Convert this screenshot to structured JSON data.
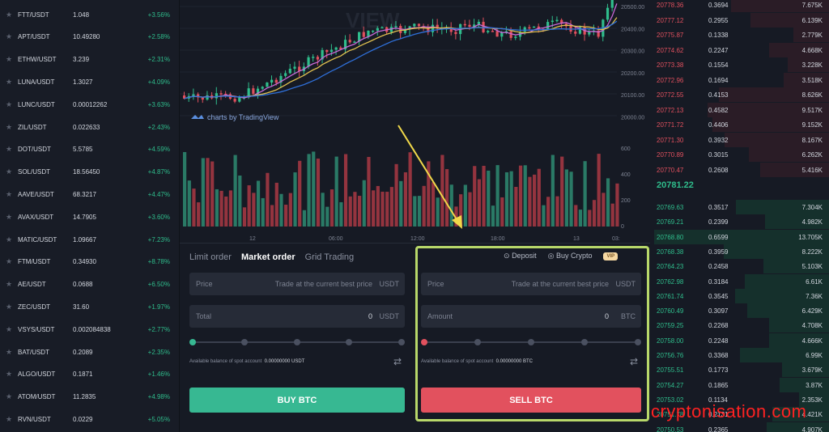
{
  "markets": [
    {
      "symbol": "FTT/USDT",
      "price": "1.048",
      "change": "+3.56%"
    },
    {
      "symbol": "APT/USDT",
      "price": "10.49280",
      "change": "+2.58%"
    },
    {
      "symbol": "ETHW/USDT",
      "price": "3.239",
      "change": "+2.31%"
    },
    {
      "symbol": "LUNA/USDT",
      "price": "1.3027",
      "change": "+4.09%"
    },
    {
      "symbol": "LUNC/USDT",
      "price": "0.00012262",
      "change": "+3.63%"
    },
    {
      "symbol": "ZIL/USDT",
      "price": "0.022633",
      "change": "+2.43%"
    },
    {
      "symbol": "DOT/USDT",
      "price": "5.5785",
      "change": "+4.59%"
    },
    {
      "symbol": "SOL/USDT",
      "price": "18.56450",
      "change": "+4.87%"
    },
    {
      "symbol": "AAVE/USDT",
      "price": "68.3217",
      "change": "+4.47%"
    },
    {
      "symbol": "AVAX/USDT",
      "price": "14.7905",
      "change": "+3.60%"
    },
    {
      "symbol": "MATIC/USDT",
      "price": "1.09667",
      "change": "+7.23%"
    },
    {
      "symbol": "FTM/USDT",
      "price": "0.34930",
      "change": "+8.78%"
    },
    {
      "symbol": "AE/USDT",
      "price": "0.0688",
      "change": "+6.50%"
    },
    {
      "symbol": "ZEC/USDT",
      "price": "31.60",
      "change": "+1.97%"
    },
    {
      "symbol": "VSYS/USDT",
      "price": "0.002084838",
      "change": "+2.77%"
    },
    {
      "symbol": "BAT/USDT",
      "price": "0.2089",
      "change": "+2.35%"
    },
    {
      "symbol": "ALGO/USDT",
      "price": "0.1871",
      "change": "+1.46%"
    },
    {
      "symbol": "ATOM/USDT",
      "price": "11.2835",
      "change": "+4.98%"
    },
    {
      "symbol": "RVN/USDT",
      "price": "0.0229",
      "change": "+5.05%"
    }
  ],
  "chart": {
    "price_ticks": [
      "20500.00",
      "20400.00",
      "20300.00",
      "20200.00",
      "20100.00",
      "20000.00"
    ],
    "volume_ticks": [
      "600",
      "400",
      "200",
      "0"
    ],
    "time_ticks": [
      "12",
      "06:00",
      "12:00",
      "18:00",
      "13",
      "03:"
    ],
    "tradingview_label": "charts by TradingView",
    "watermark_text": "VIEW"
  },
  "orderbook": {
    "asks": [
      {
        "price": "20778.36",
        "amount": "0.3694",
        "total": "7.675K"
      },
      {
        "price": "20777.12",
        "amount": "0.2955",
        "total": "6.139K"
      },
      {
        "price": "20775.87",
        "amount": "0.1338",
        "total": "2.779K"
      },
      {
        "price": "20774.62",
        "amount": "0.2247",
        "total": "4.668K"
      },
      {
        "price": "20773.38",
        "amount": "0.1554",
        "total": "3.228K"
      },
      {
        "price": "20772.96",
        "amount": "0.1694",
        "total": "3.518K"
      },
      {
        "price": "20772.55",
        "amount": "0.4153",
        "total": "8.626K"
      },
      {
        "price": "20772.13",
        "amount": "0.4582",
        "total": "9.517K"
      },
      {
        "price": "20771.72",
        "amount": "0.4406",
        "total": "9.152K"
      },
      {
        "price": "20771.30",
        "amount": "0.3932",
        "total": "8.167K"
      },
      {
        "price": "20770.89",
        "amount": "0.3015",
        "total": "6.262K"
      },
      {
        "price": "20770.47",
        "amount": "0.2608",
        "total": "5.416K"
      }
    ],
    "last_price": "20781.22",
    "bids": [
      {
        "price": "20769.63",
        "amount": "0.3517",
        "total": "7.304K"
      },
      {
        "price": "20769.21",
        "amount": "0.2399",
        "total": "4.982K"
      },
      {
        "price": "20768.80",
        "amount": "0.6599",
        "total": "13.705K"
      },
      {
        "price": "20768.38",
        "amount": "0.3959",
        "total": "8.222K"
      },
      {
        "price": "20764.23",
        "amount": "0.2458",
        "total": "5.103K"
      },
      {
        "price": "20762.98",
        "amount": "0.3184",
        "total": "6.61K"
      },
      {
        "price": "20761.74",
        "amount": "0.3545",
        "total": "7.36K"
      },
      {
        "price": "20760.49",
        "amount": "0.3097",
        "total": "6.429K"
      },
      {
        "price": "20759.25",
        "amount": "0.2268",
        "total": "4.708K"
      },
      {
        "price": "20758.00",
        "amount": "0.2248",
        "total": "4.666K"
      },
      {
        "price": "20756.76",
        "amount": "0.3368",
        "total": "6.99K"
      },
      {
        "price": "20755.51",
        "amount": "0.1773",
        "total": "3.679K"
      },
      {
        "price": "20754.27",
        "amount": "0.1865",
        "total": "3.87K"
      },
      {
        "price": "20753.02",
        "amount": "0.1134",
        "total": "2.353K"
      },
      {
        "price": "20751.78",
        "amount": "0.2131",
        "total": "4.421K"
      },
      {
        "price": "20750.53",
        "amount": "0.2365",
        "total": "4.907K"
      }
    ]
  },
  "trade": {
    "tabs": [
      "Limit order",
      "Market order",
      "Grid Trading"
    ],
    "buy": {
      "price_label": "Price",
      "price_hint": "Trade at the current best price",
      "price_unit": "USDT",
      "total_label": "Total",
      "total_value": "0",
      "total_unit": "USDT",
      "balance_label": "Available balance of spot account",
      "balance_value": "0.00000000 USDT",
      "button": "BUY BTC"
    },
    "sell": {
      "deposit": "Deposit",
      "buy_crypto": "Buy Crypto",
      "vip": "VIP",
      "price_label": "Price",
      "price_hint": "Trade at the current best price",
      "price_unit": "USDT",
      "amount_label": "Amount",
      "amount_value": "0",
      "amount_unit": "BTC",
      "balance_label": "Available balance of spot account",
      "balance_value": "0.00000000 BTC",
      "button": "SELL BTC"
    }
  },
  "watermark": "cryptonisation.com",
  "colors": {
    "up": "#2fbd8c",
    "down": "#e0505e",
    "buy": "#37b892",
    "sell": "#e2515e",
    "highlight": "#b8d86a"
  }
}
